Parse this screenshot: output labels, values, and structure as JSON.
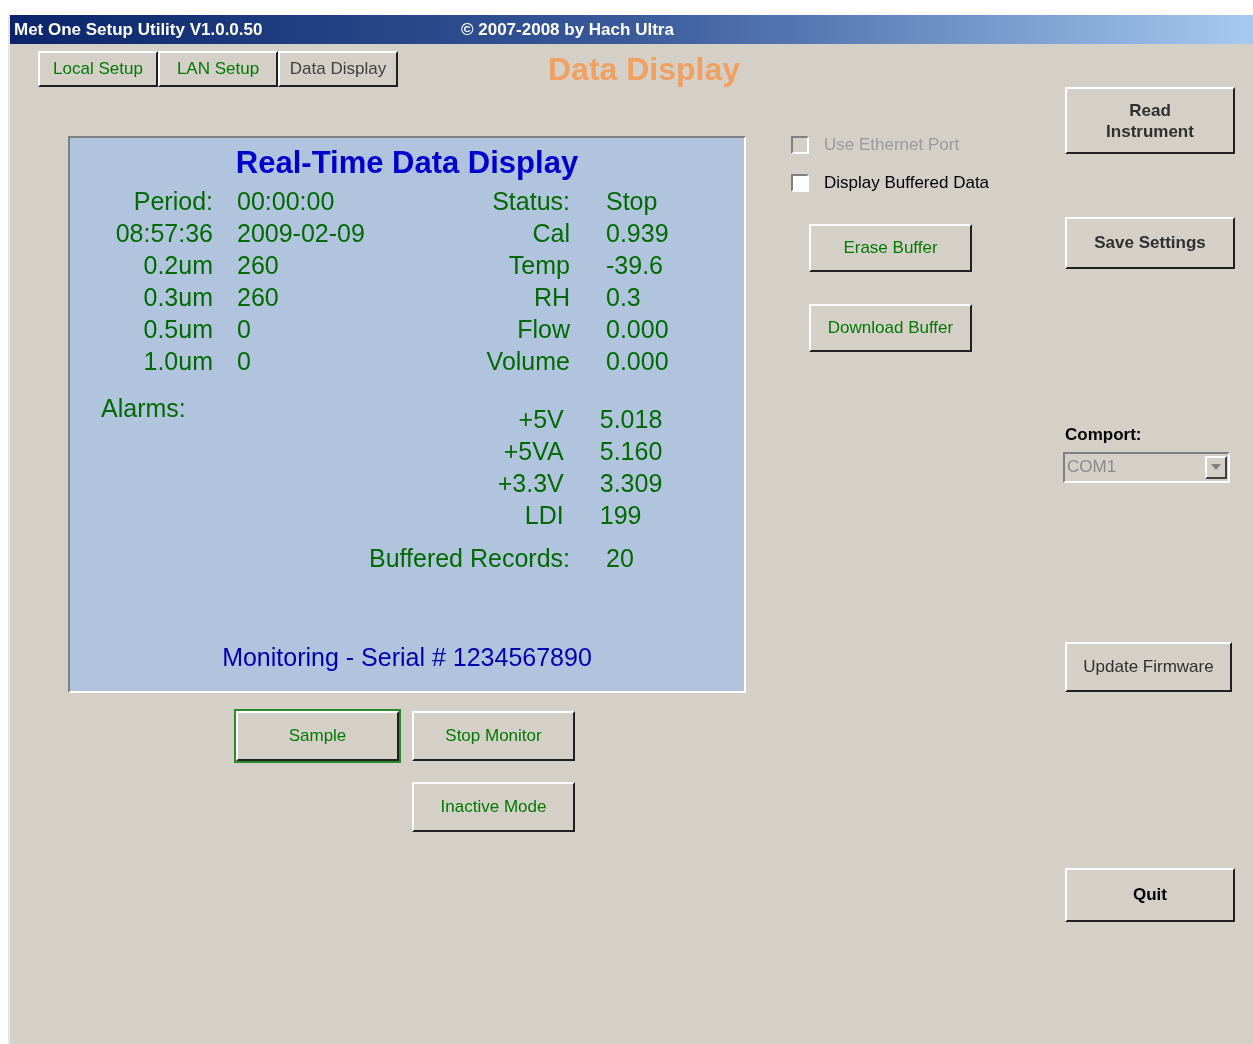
{
  "title_bar": {
    "title": "Met One Setup Utility V1.0.0.50",
    "copyright": "© 2007-2008 by Hach Ultra"
  },
  "tabs": [
    {
      "label": "Local Setup",
      "selected": false
    },
    {
      "label": "LAN Setup",
      "selected": false
    },
    {
      "label": "Data Display",
      "selected": true
    }
  ],
  "page_heading": "Data Display",
  "display": {
    "title": "Real-Time Data Display",
    "rows": [
      {
        "label": "Period:",
        "value": "00:00:00",
        "label_2": "Status:",
        "value_2": "Stop"
      },
      {
        "label": "08:57:36",
        "value": "2009-02-09",
        "label_2": "Cal",
        "value_2": "0.939"
      },
      {
        "label": "0.2um",
        "value": "260",
        "label_2": "Temp",
        "value_2": "-39.6"
      },
      {
        "label": "0.3um",
        "value": "260",
        "label_2": "RH",
        "value_2": "0.3"
      },
      {
        "label": "0.5um",
        "value": "0",
        "label_2": "Flow",
        "value_2": "0.000"
      },
      {
        "label": "1.0um",
        "value": "0",
        "label_2": "Volume",
        "value_2": "0.000"
      }
    ],
    "alarms_label": "Alarms:",
    "power_rows": [
      {
        "label": "+5V",
        "value": "5.018"
      },
      {
        "label": "+5VA",
        "value": "5.160"
      },
      {
        "label": "+3.3V",
        "value": "3.309"
      },
      {
        "label": "LDI",
        "value": "199"
      }
    ],
    "buffered": {
      "label": "Buffered Records:",
      "value": "20"
    },
    "footer": "Monitoring - Serial # 1234567890"
  },
  "display_buttons": [
    {
      "label": "Sample",
      "focused": true
    },
    {
      "label": "Stop Monitor",
      "focused": false
    },
    {
      "label": "Inactive Mode",
      "focused": false
    }
  ],
  "checkboxes": [
    {
      "label": "Use Ethernet Port",
      "checked": false,
      "disabled": true
    },
    {
      "label": "Display Buffered Data",
      "checked": false,
      "disabled": false
    }
  ],
  "buffer_buttons": [
    "Erase Buffer",
    "Download Buffer"
  ],
  "read_button": "Read Instrument",
  "save_button": "Save Settings",
  "comport": {
    "label": "Comport:",
    "value": "COM1",
    "disabled": true
  },
  "firmware_button": "Update Firmware",
  "quit_button": "Quit"
}
